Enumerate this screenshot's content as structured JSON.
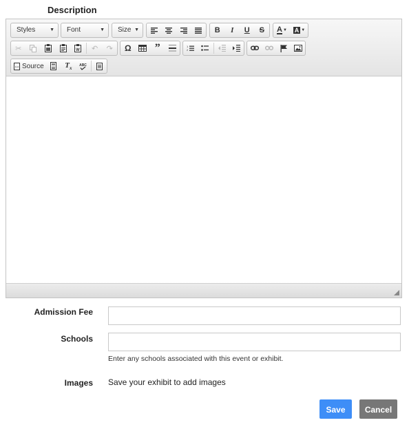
{
  "description": {
    "label": "Description"
  },
  "editor": {
    "combos": {
      "styles": "Styles",
      "font": "Font",
      "size": "Size"
    },
    "source_label": "Source",
    "buttons_row1": [
      "align-left",
      "align-center",
      "align-right",
      "justify",
      "bold",
      "italic",
      "underline",
      "strikethrough",
      "text-color",
      "background-color"
    ],
    "buttons_row2": [
      "cut",
      "copy",
      "paste",
      "paste-text",
      "paste-from-word",
      "undo",
      "redo",
      "special-character",
      "table",
      "blockquote",
      "horizontal-line",
      "numbered-list",
      "bulleted-list",
      "decrease-indent",
      "increase-indent",
      "link",
      "unlink",
      "anchor",
      "image"
    ],
    "buttons_row3": [
      "source",
      "templates",
      "remove-format",
      "spell-check",
      "document"
    ],
    "body_text": ""
  },
  "admission_fee": {
    "label": "Admission Fee",
    "value": ""
  },
  "schools": {
    "label": "Schools",
    "value": "",
    "help": "Enter any schools associated with this event or exhibit."
  },
  "images": {
    "label": "Images",
    "text": "Save your exhibit to add images"
  },
  "actions": {
    "save": "Save",
    "cancel": "Cancel"
  }
}
